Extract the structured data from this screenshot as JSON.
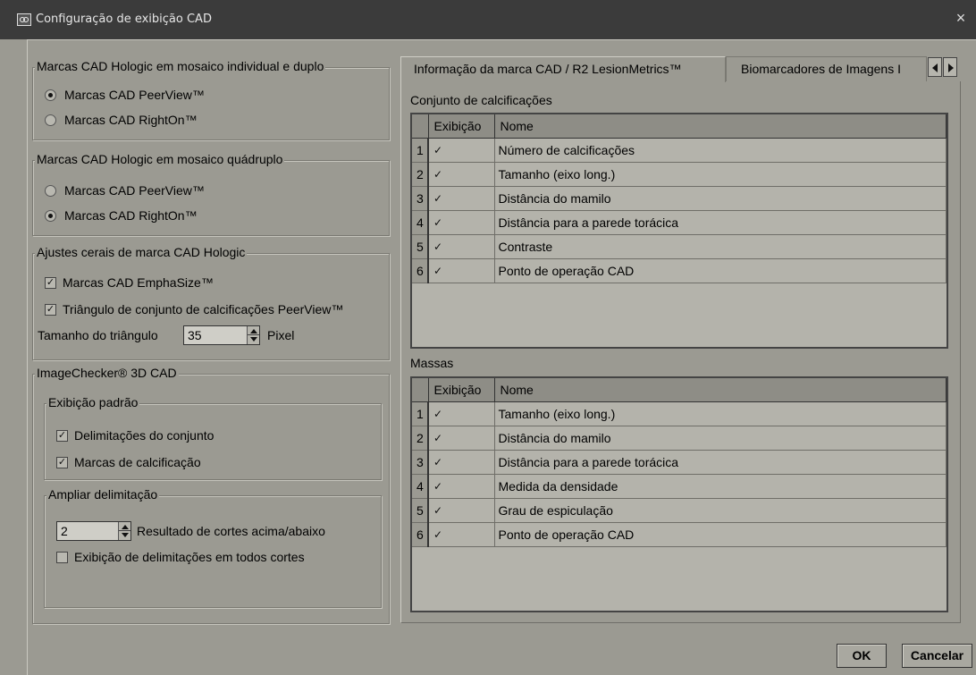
{
  "window": {
    "title": "Configuração de exibição CAD",
    "close_glyph": "×"
  },
  "left": {
    "group1": {
      "legend": "Marcas CAD Hologic em mosaico individual e duplo",
      "options": [
        {
          "label": "Marcas CAD PeerView™",
          "selected": true
        },
        {
          "label": "Marcas CAD RightOn™",
          "selected": false
        }
      ]
    },
    "group2": {
      "legend": "Marcas CAD Hologic em mosaico quádruplo",
      "options": [
        {
          "label": "Marcas CAD PeerView™",
          "selected": false
        },
        {
          "label": "Marcas CAD RightOn™",
          "selected": true
        }
      ]
    },
    "group3": {
      "legend": "Ajustes cerais de marca CAD Hologic",
      "emphasize": "Marcas CAD EmphaSize™",
      "triangle": "Triângulo de conjunto de calcificações PeerView™",
      "size_label": "Tamanho do triângulo",
      "size_value": "35",
      "size_unit": "Pixel"
    },
    "group4": {
      "legend": "ImageChecker® 3D CAD",
      "sub1": {
        "legend": "Exibição padrão",
        "opt1": "Delimitações do conjunto",
        "opt2": "Marcas de calcificação"
      },
      "sub2": {
        "legend": "Ampliar delimitação",
        "slices_value": "2",
        "slices_label": "Resultado de cortes acima/abaixo",
        "all_slices": "Exibição de delimitações em todos cortes"
      }
    }
  },
  "tabs": {
    "items": [
      "Informação da marca CAD / R2 LesionMetrics™",
      "Biomarcadores de Imagens I"
    ],
    "active": 0
  },
  "calc": {
    "label": "Conjunto de calcificações",
    "columns": [
      "Exibição",
      "Nome"
    ],
    "rows": [
      {
        "n": "1",
        "name": "Número de calcificações",
        "checked": true
      },
      {
        "n": "2",
        "name": "Tamanho (eixo long.)",
        "checked": true
      },
      {
        "n": "3",
        "name": "Distância do mamilo",
        "checked": true
      },
      {
        "n": "4",
        "name": "Distância para a parede torácica",
        "checked": true
      },
      {
        "n": "5",
        "name": "Contraste",
        "checked": true
      },
      {
        "n": "6",
        "name": "Ponto de operação CAD",
        "checked": true
      }
    ]
  },
  "mass": {
    "label": "Massas",
    "columns": [
      "Exibição",
      "Nome"
    ],
    "rows": [
      {
        "n": "1",
        "name": "Tamanho (eixo long.)",
        "checked": true
      },
      {
        "n": "2",
        "name": "Distância do mamilo",
        "checked": true
      },
      {
        "n": "3",
        "name": "Distância para a parede torácica",
        "checked": true
      },
      {
        "n": "4",
        "name": "Medida da densidade",
        "checked": true
      },
      {
        "n": "5",
        "name": "Grau de espiculação",
        "checked": true
      },
      {
        "n": "6",
        "name": "Ponto de operação CAD",
        "checked": true
      }
    ]
  },
  "buttons": {
    "ok": "OK",
    "cancel": "Cancelar"
  },
  "check_glyph": "✓"
}
